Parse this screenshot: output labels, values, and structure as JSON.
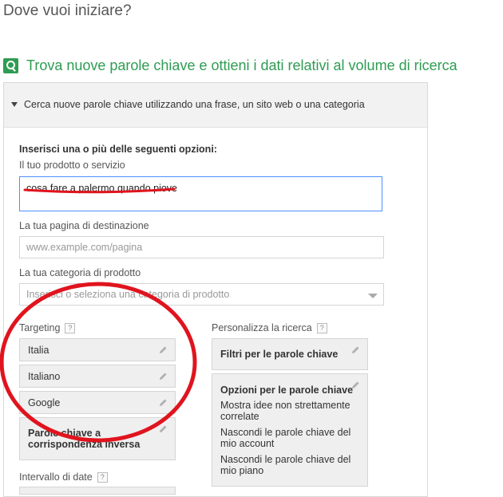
{
  "page": {
    "heading": "Dove vuoi iniziare?",
    "section_title": "Trova nuove parole chiave e ottieni i dati relativi al volume di ricerca"
  },
  "panel": {
    "header": "Cerca nuove parole chiave utilizzando una frase, un sito web o una categoria",
    "intro": "Inserisci una o più delle seguenti opzioni:",
    "product_label": "Il tuo prodotto o servizio",
    "product_value": "cosa fare a palermo quando piove",
    "landing_label": "La tua pagina di destinazione",
    "landing_placeholder": "www.example.com/pagina",
    "category_label": "La tua categoria di prodotto",
    "category_placeholder": "Inserisci o seleziona una categoria di prodotto"
  },
  "targeting": {
    "label": "Targeting",
    "help": "?",
    "chips": [
      "Italia",
      "Italiano",
      "Google"
    ],
    "negative_line1": "Parole chiave a",
    "negative_line2": "corrispondenza inversa"
  },
  "customize": {
    "label": "Personalizza la ricerca",
    "help": "?",
    "filters": "Filtri per le parole chiave",
    "options_title": "Opzioni per le parole chiave",
    "option1_line1": "Mostra idee non strettamente",
    "option1_line2": "correlate",
    "option2_line1": "Nascondi le parole chiave del",
    "option2_line2": "mio account",
    "option3_line1": "Nascondi le parole chiave del",
    "option3_line2": "mio piano"
  },
  "date_range": {
    "label": "Intervallo di date",
    "help": "?"
  },
  "annotation": {
    "color": "#e0141e"
  }
}
